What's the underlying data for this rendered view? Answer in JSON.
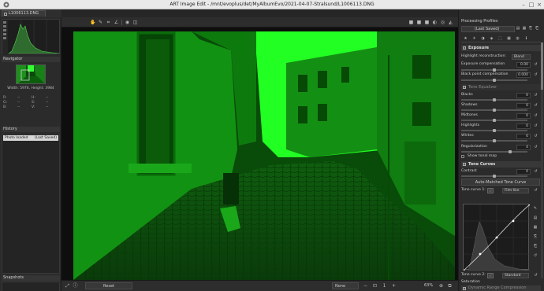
{
  "window": {
    "title": "ART Image Edit - /mnt/evoplus/det/MyAlbumEvo/2021-04-07-Stralsund/L1006113.DNG"
  },
  "tab": {
    "label": "L1006113.DNG"
  },
  "left_panel": {
    "navigator_label": "Navigator",
    "nav_info": "Width: 5976, Height: 3984",
    "nav_readouts": [
      [
        "R: ",
        "--",
        "H: ",
        "--"
      ],
      [
        "G: ",
        "--",
        "S: ",
        "--"
      ],
      [
        "B: ",
        "--",
        "V: ",
        "--"
      ]
    ],
    "history_label": "History",
    "history_items": [
      {
        "action": "Photo loaded",
        "value": "(Last Saved)"
      }
    ],
    "snapshots_label": "Snapshots"
  },
  "bottom_bar": {
    "reset_label": "Reset",
    "preview_mode": "None",
    "zoom": "63%"
  },
  "right_panel": {
    "profiles_label": "Processing Profiles",
    "profile_value": "(Last Saved)",
    "exposure": {
      "title": "Exposure",
      "highlight_recon_label": "Highlight reconstruction:",
      "highlight_recon_value": "Blend",
      "exposure_comp_label": "Exposure compensation",
      "exposure_comp_value": "0.00",
      "black_point_label": "Black point compensation",
      "black_point_value": "0.000"
    },
    "tone_eq": {
      "title": "Tone Equalizer",
      "rows": [
        {
          "label": "Blacks",
          "value": "0"
        },
        {
          "label": "Shadows",
          "value": "0"
        },
        {
          "label": "Midtones",
          "value": "0"
        },
        {
          "label": "Highlights",
          "value": "0"
        },
        {
          "label": "Whites",
          "value": "0"
        }
      ],
      "regularization_label": "Regularization",
      "regularization_value": "4",
      "show_map_label": "Show tonal map"
    },
    "tone_curves": {
      "title": "Tone Curves",
      "contrast_label": "Contrast",
      "contrast_value": "0",
      "auto_button": "Auto-Matched Tone Curve",
      "curve1_label": "Tone curve 1:",
      "curve1_mode": "Film-like",
      "curve2_label": "Tone curve 2:",
      "curve2_mode": "Standard",
      "saturation_label": "Saturation",
      "dynamic_label": "Dynamic Range Compression"
    }
  },
  "colors": {
    "photo_green": "#0f7a0f",
    "panel_bg": "#2b2b2b",
    "titlebar_bg": "#e9e9e9"
  }
}
